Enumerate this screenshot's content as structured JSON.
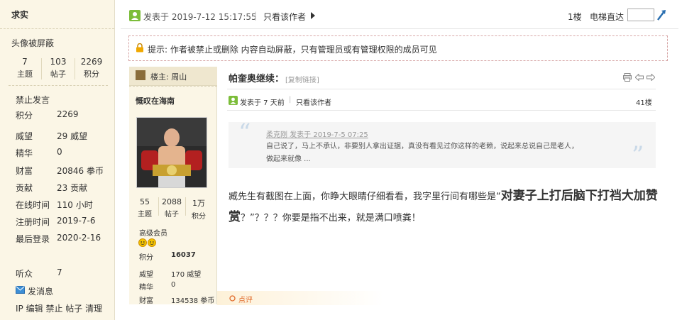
{
  "sidebar": {
    "title": "求实",
    "avatar_blocked": "头像被屏蔽",
    "stats": [
      {
        "value": "7",
        "label": "主题"
      },
      {
        "value": "103",
        "label": "帖子"
      },
      {
        "value": "2269",
        "label": "积分"
      }
    ],
    "status": "禁止发言",
    "profile": [
      {
        "label": "积分",
        "value": "2269"
      },
      {
        "label": "威望",
        "value": "29 威望"
      },
      {
        "label": "精华",
        "value": "0"
      },
      {
        "label": "财富",
        "value": "20846 拳币"
      },
      {
        "label": "贡献",
        "value": "23 贡献"
      },
      {
        "label": "在线时间",
        "value": "110 小时"
      },
      {
        "label": "注册时间",
        "value": "2019-7-6"
      },
      {
        "label": "最后登录",
        "value": "2020-2-16"
      }
    ],
    "listeners_label": "听众",
    "listeners_value": "7",
    "send_message": "发消息",
    "admin_links": [
      "IP",
      "编辑",
      "禁止",
      "帖子",
      "清理"
    ]
  },
  "header": {
    "posted_at": "发表于 2019-7-12 15:17:55",
    "only_author": "只看该作者",
    "floor": "1楼",
    "elevator_label": "电梯直达",
    "elevator_value": ""
  },
  "notice": {
    "text": "提示: 作者被禁止或删除 内容自动屏蔽，只有管理员或有管理权限的成员可见"
  },
  "inner": {
    "owner_label": "楼主:",
    "owner_name": "周山",
    "author": "慨叹在海南",
    "stats": [
      {
        "value": "55",
        "label": "主题"
      },
      {
        "value": "2088",
        "label": "帖子"
      },
      {
        "value": "1万",
        "label": "积分"
      }
    ],
    "group": "高级会员",
    "profile": [
      {
        "label": "积分",
        "value": "16037"
      },
      {
        "label": "威望",
        "value": "170 威望"
      },
      {
        "label": "精华",
        "value": "0"
      },
      {
        "label": "财富",
        "value": "134538 拳币"
      }
    ],
    "title": "帕奎奥继续：",
    "copy_link": "[复制链接]",
    "posted_at": "发表于 7 天前",
    "only_author": "只看该作者",
    "floor": "41楼",
    "quote_author": "柔克刚 发表于 2019-7-5 07:25",
    "quote_line1": "自己说了，马上不承认，非要别人拿出证据，真没有看见过你这样的老赖，说起来总说自己是老人，",
    "quote_line2": "做起来就像 ...",
    "body_part1": "臧先生有截图在上面，你睁大眼睛仔细看看，我字里行间有哪些是“",
    "body_bold": "对妻子上打后脑下打裆大加赞赏",
    "body_part2": "？”？？？你要是指不出来，就是满口喷粪！",
    "reply_label": "点评"
  }
}
